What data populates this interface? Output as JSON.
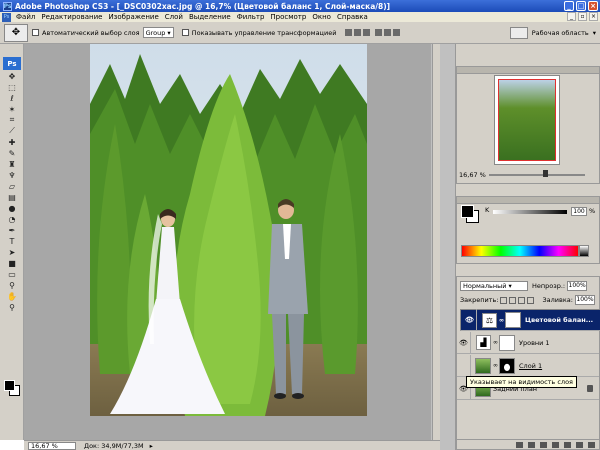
{
  "window": {
    "title": "Adobe Photoshop CS3 - [_DSC0302хас.jpg @ 16,7% (Цветовой баланс 1, Слой-маска/8)]",
    "logo_text": "Ps",
    "buttons": [
      "_",
      "□",
      "×"
    ]
  },
  "menu": {
    "items": [
      "Файл",
      "Редактирование",
      "Изображение",
      "Слой",
      "Выделение",
      "Фильтр",
      "Просмотр",
      "Окно",
      "Справка"
    ]
  },
  "options": {
    "auto_select_label": "Автоматический выбор слоя",
    "auto_select_value": "Group",
    "show_transform_label": "Показывать управление трансформацией",
    "workspace_label": "Рабочая область"
  },
  "tools": {
    "ps_label": "Ps",
    "icons": [
      "move-icon",
      "marquee-icon",
      "lasso-icon",
      "magic-wand-icon",
      "crop-icon",
      "slice-icon",
      "healing-icon",
      "brush-icon",
      "stamp-icon",
      "history-brush-icon",
      "eraser-icon",
      "gradient-icon",
      "blur-icon",
      "dodge-icon",
      "pen-icon",
      "type-icon",
      "path-select-icon",
      "shape-icon",
      "notes-icon",
      "eyedropper-icon",
      "hand-icon",
      "zoom-icon"
    ]
  },
  "status": {
    "zoom": "16,67 %",
    "doc": "Док: 34,9M/77,3M"
  },
  "navigator": {
    "zoom": "16,67 %"
  },
  "color": {
    "channel": "K",
    "value": "100",
    "unit": "%"
  },
  "layers": {
    "blend_mode": "Нормальный",
    "opacity_label": "Непрозр.:",
    "opacity": "100%",
    "lock_label": "Закрепить:",
    "fill_label": "Заливка:",
    "fill": "100%",
    "items": [
      {
        "name": "Цветовой балан...",
        "selected": true,
        "kind": "adjustment"
      },
      {
        "name": "Уровни 1",
        "selected": false,
        "kind": "levels"
      },
      {
        "name": "Слой 1",
        "selected": false,
        "kind": "image"
      },
      {
        "name": "Задний план",
        "selected": false,
        "kind": "background"
      }
    ],
    "tooltip": "Указывает на видимость слоя"
  }
}
